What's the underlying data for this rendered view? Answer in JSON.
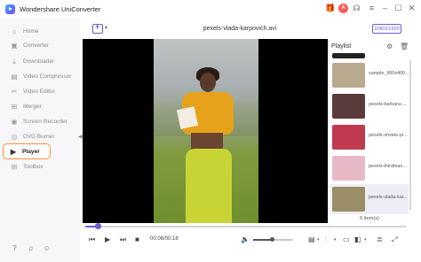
{
  "app": {
    "title": "Wondershare UniConverter"
  },
  "header": {
    "file_title": "pexels-vlada-karpovich.avi",
    "resolution": "1080X1920"
  },
  "sidebar": {
    "items": [
      {
        "label": "Home",
        "icon": "home-icon"
      },
      {
        "label": "Converter",
        "icon": "converter-icon"
      },
      {
        "label": "Downloader",
        "icon": "downloader-icon"
      },
      {
        "label": "Video Compressor",
        "icon": "compress-icon"
      },
      {
        "label": "Video Editor",
        "icon": "scissors-icon"
      },
      {
        "label": "Merger",
        "icon": "merge-icon"
      },
      {
        "label": "Screen Recorder",
        "icon": "record-icon"
      },
      {
        "label": "DVD Burner",
        "icon": "disc-icon"
      },
      {
        "label": "Player",
        "icon": "play-icon"
      },
      {
        "label": "Toolbox",
        "icon": "grid-icon"
      }
    ],
    "active": "Player"
  },
  "playlist": {
    "title": "Playlist",
    "items": [
      {
        "label": "sample_960x400...",
        "thumb": "#b9a98f"
      },
      {
        "label": "pexels-barbara-...",
        "thumb": "#5a3b3b"
      },
      {
        "label": "pexels-shvets-pr...",
        "thumb": "#c23a52"
      },
      {
        "label": "pexels-thirdman...",
        "thumb": "#e7b9c6"
      },
      {
        "label": "pexels-vlada-kar...",
        "thumb": "#9b8d65"
      }
    ],
    "count": "6 item(s)"
  },
  "player": {
    "time": "00:06/00:18",
    "progress": 0.04,
    "volume": 0.45
  },
  "colors": {
    "accent": "#6b5cd6",
    "active_border": "#ff8c3a"
  }
}
